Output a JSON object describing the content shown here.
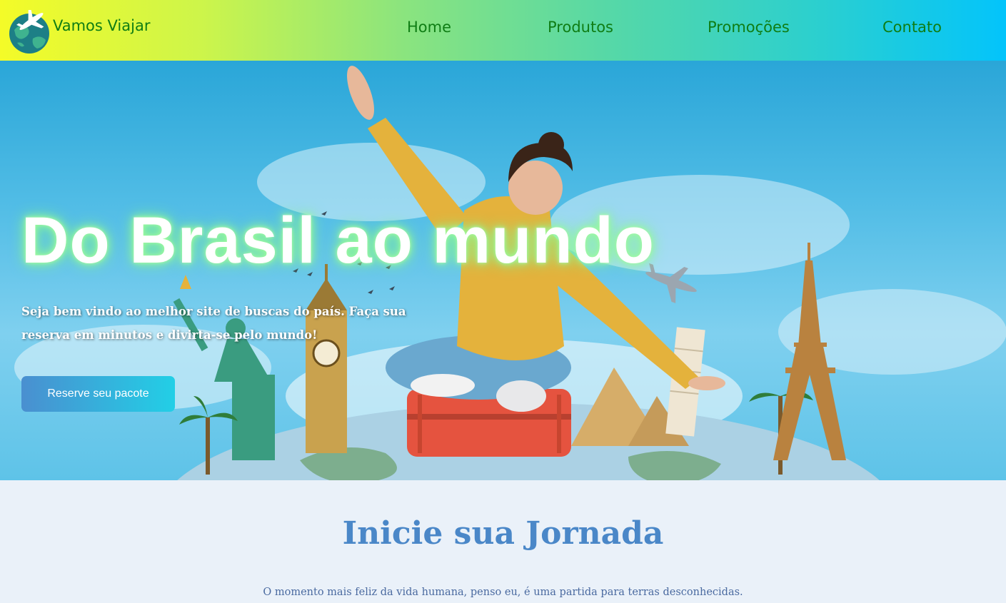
{
  "header": {
    "brand": "Vamos Viajar",
    "logo_icon": "globe-airplane-icon",
    "nav": [
      {
        "label": "Home"
      },
      {
        "label": "Produtos"
      },
      {
        "label": "Promoções"
      },
      {
        "label": "Contato"
      }
    ],
    "colors": {
      "gradient_start": "#f4fb28",
      "gradient_end": "#03c4fb",
      "nav_text": "#0f7d14"
    }
  },
  "hero": {
    "title": "Do Brasil ao mundo",
    "subtitle": "Seja bem vindo ao melhor site de buscas do país. Faça sua reserva em minutos e divirta-se pelo mundo!",
    "cta_label": "Reserve seu pacote"
  },
  "journey": {
    "title": "Inicie sua Jornada",
    "quote": "O momento mais feliz da vida humana, penso eu, é uma partida para terras desconhecidas."
  }
}
